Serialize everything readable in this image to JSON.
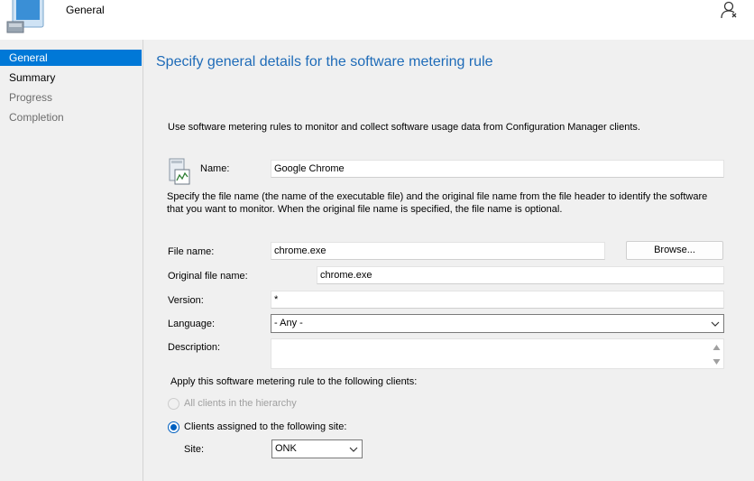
{
  "header": {
    "title": "General"
  },
  "nav": {
    "items": [
      {
        "label": "General",
        "state": "selected"
      },
      {
        "label": "Summary",
        "state": "normal"
      },
      {
        "label": "Progress",
        "state": "disabled"
      },
      {
        "label": "Completion",
        "state": "disabled"
      }
    ]
  },
  "main": {
    "title": "Specify general details for the software metering rule",
    "intro": "Use software metering rules to monitor and collect software usage data from Configuration Manager clients.",
    "name_label": "Name:",
    "name_value": "Google Chrome",
    "file_description": "Specify the file name (the name of the executable file) and the original file name from the file header to identify the software that you want to monitor. When the original file name is specified, the file name is optional.",
    "file_name_label": "File name:",
    "file_name_value": "chrome.exe",
    "browse_label": "Browse...",
    "original_file_name_label": "Original file name:",
    "original_file_name_value": "chrome.exe",
    "version_label": "Version:",
    "version_value": "*",
    "language_label": "Language:",
    "language_value": "- Any -",
    "description_label": "Description:",
    "description_value": "",
    "apply_label": "Apply this software metering rule to the following clients:",
    "radio_all_clients": "All clients in the hierarchy",
    "radio_assigned_site": "Clients assigned to the following site:",
    "site_label": "Site:",
    "site_value": "ONK"
  },
  "colors": {
    "accent": "#0078d7",
    "title_blue": "#1e6bb8"
  },
  "icons": {
    "header": "computer-wizard-icon",
    "help": "user-help-icon",
    "rule": "metering-rule-icon"
  }
}
